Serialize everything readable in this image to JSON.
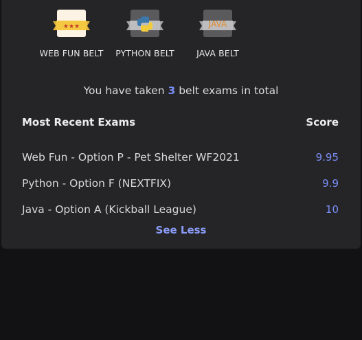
{
  "belts": [
    {
      "label": "WEB FUN BELT",
      "icon": "web-fun-belt-icon",
      "color": "#f5c842"
    },
    {
      "label": "PYTHON BELT",
      "icon": "python-belt-icon",
      "color": "#5c5c5e"
    },
    {
      "label": "JAVA BELT",
      "icon": "java-belt-icon",
      "color": "#5c5c5e",
      "badge_text": "JAVA"
    }
  ],
  "summary": {
    "prefix": "You have taken",
    "count": "3",
    "suffix": "belt exams in total"
  },
  "table": {
    "header_title": "Most Recent Exams",
    "header_score": "Score",
    "rows": [
      {
        "name": "Web Fun - Option P - Pet Shelter WF2021",
        "score": "9.95"
      },
      {
        "name": "Python - Option F (NEXTFIX)",
        "score": "9.9"
      },
      {
        "name": "Java - Option A (Kickball League)",
        "score": "10"
      }
    ]
  },
  "toggle_label": "See Less",
  "colors": {
    "accent": "#7a8ff7",
    "card_bg": "#252427",
    "page_bg": "#121113"
  }
}
